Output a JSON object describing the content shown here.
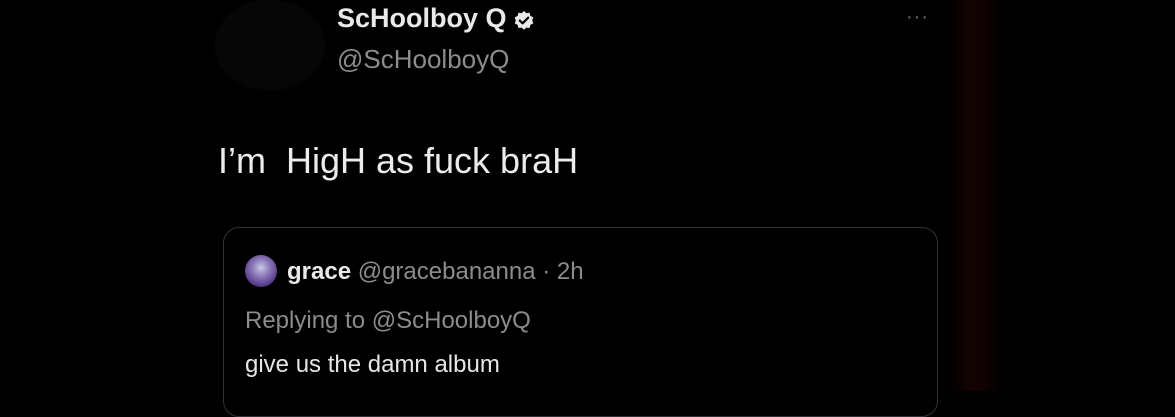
{
  "tweet": {
    "author": {
      "name": "ScHoolboy Q",
      "handle": "@ScHoolboyQ",
      "verified_icon": "verified-badge-icon"
    },
    "more_label": "···",
    "text": "I’m  HigH as fuck braH"
  },
  "quote": {
    "author_name": "grace",
    "author_handle": "@gracebananna",
    "separator": " · ",
    "time": "2h",
    "replying_to": "Replying to @ScHoolboyQ",
    "text": "give us the damn album"
  },
  "colors": {
    "background": "#000000",
    "primary_text": "#e9e9e9",
    "secondary_text": "#8c8c8c",
    "card_border": "#2f3336"
  }
}
